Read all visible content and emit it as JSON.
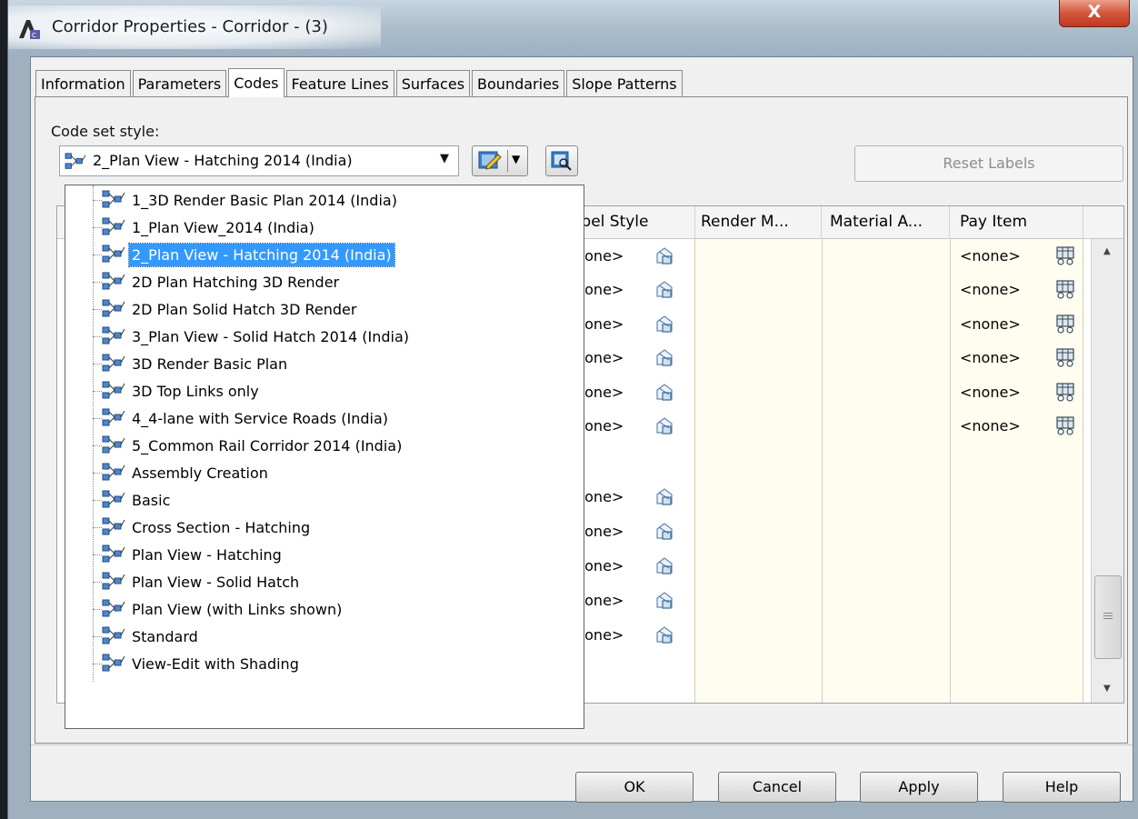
{
  "window": {
    "title": "Corridor Properties - Corridor - (3)",
    "close_label": "X"
  },
  "tabs": [
    {
      "label": "Information",
      "active": false
    },
    {
      "label": "Parameters",
      "active": false
    },
    {
      "label": "Codes",
      "active": true
    },
    {
      "label": "Feature Lines",
      "active": false
    },
    {
      "label": "Surfaces",
      "active": false
    },
    {
      "label": "Boundaries",
      "active": false
    },
    {
      "label": "Slope Patterns",
      "active": false
    }
  ],
  "codes": {
    "code_set_label": "Code set style:",
    "selected_style": "2_Plan View - Hatching 2014 (India)",
    "reset_labels": "Reset Labels"
  },
  "grid": {
    "columns": [
      "abel Style",
      "Render M...",
      "Material A...",
      "Pay Item"
    ],
    "rows": [
      {
        "label_style": "none>",
        "pay_item": "<none>"
      },
      {
        "label_style": "none>",
        "pay_item": "<none>"
      },
      {
        "label_style": "none>",
        "pay_item": "<none>"
      },
      {
        "label_style": "none>",
        "pay_item": "<none>"
      },
      {
        "label_style": "none>",
        "pay_item": "<none>"
      },
      {
        "label_style": "none>",
        "pay_item": "<none>"
      },
      {
        "label_style": "none>",
        "pay_item": ""
      },
      {
        "label_style": "none>",
        "pay_item": ""
      },
      {
        "label_style": "none>",
        "pay_item": ""
      },
      {
        "label_style": "none>",
        "pay_item": ""
      },
      {
        "label_style": "none>",
        "pay_item": ""
      }
    ]
  },
  "dropdown": {
    "items": [
      "1_3D Render Basic Plan 2014 (India)",
      "1_Plan View_2014 (India)",
      "2_Plan View - Hatching 2014 (India)",
      "2D Plan Hatching 3D Render",
      "2D Plan Solid Hatch 3D Render",
      "3_Plan View - Solid Hatch 2014 (India)",
      "3D Render Basic Plan",
      "3D Top Links only",
      "4_4-lane with Service Roads (India)",
      "5_Common Rail Corridor 2014 (India)",
      "Assembly Creation",
      "Basic",
      "Cross Section - Hatching",
      "Plan View - Hatching",
      "Plan View - Solid Hatch",
      "Plan View (with Links shown)",
      "Standard",
      "View-Edit with Shading"
    ],
    "selected_index": 2
  },
  "buttons": {
    "ok": "OK",
    "cancel": "Cancel",
    "apply": "Apply",
    "help": "Help"
  },
  "colors": {
    "selection": "#3399ff",
    "close_button": "#c0391f",
    "grid_editable_bg": "#fffdf0"
  }
}
